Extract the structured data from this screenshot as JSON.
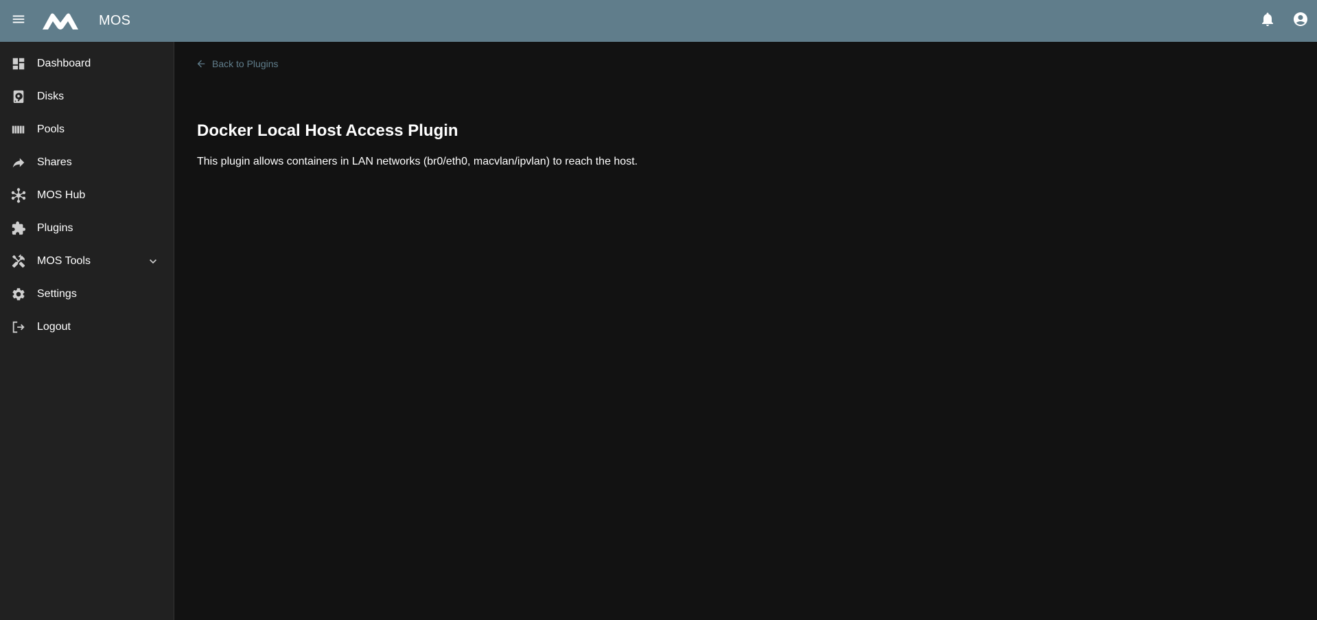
{
  "header": {
    "app_title": "MOS",
    "menu_icon": "menu-icon",
    "logo_icon": "mos-logo",
    "notifications_icon": "bell-icon",
    "account_icon": "account-circle-icon",
    "bar_color": "#607d8b"
  },
  "sidebar": {
    "items": [
      {
        "label": "Dashboard",
        "icon": "dashboard-icon"
      },
      {
        "label": "Disks",
        "icon": "disk-icon"
      },
      {
        "label": "Pools",
        "icon": "pools-icon"
      },
      {
        "label": "Shares",
        "icon": "share-icon"
      },
      {
        "label": "MOS Hub",
        "icon": "hub-icon"
      },
      {
        "label": "Plugins",
        "icon": "puzzle-icon"
      },
      {
        "label": "MOS Tools",
        "icon": "tools-icon",
        "expandable": true
      },
      {
        "label": "Settings",
        "icon": "gear-icon"
      },
      {
        "label": "Logout",
        "icon": "logout-icon"
      }
    ]
  },
  "main": {
    "back_link": "Back to Plugins",
    "title": "Docker Local Host Access Plugin",
    "description": "This plugin allows containers in LAN networks (br0/eth0, macvlan/ipvlan) to reach the host."
  },
  "colors": {
    "accent": "#607d8b",
    "sidebar_bg": "#212121",
    "main_bg": "#121212"
  }
}
